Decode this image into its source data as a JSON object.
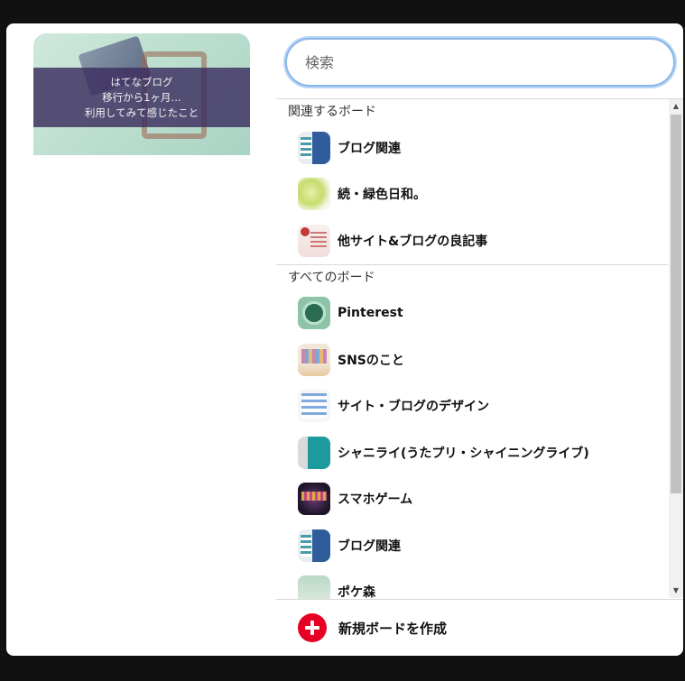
{
  "preview": {
    "lines": [
      "はてなブログ",
      "移行から1ヶ月…",
      "利用してみて感じたこと"
    ]
  },
  "search": {
    "placeholder": "検索",
    "value": ""
  },
  "related_section": {
    "title": "関連するボード",
    "items": [
      {
        "name": "ブログ関連",
        "icon": "blog-thumbnail"
      },
      {
        "name": "続・緑色日和。",
        "icon": "green-thumbnail"
      },
      {
        "name": "他サイト&ブログの良記事",
        "icon": "articles-thumbnail"
      }
    ]
  },
  "all_section": {
    "title": "すべてのボード",
    "items": [
      {
        "name": "Pinterest",
        "icon": "pinterest-thumbnail"
      },
      {
        "name": "SNSのこと",
        "icon": "sns-thumbnail"
      },
      {
        "name": "サイト・ブログのデザイン",
        "icon": "design-thumbnail"
      },
      {
        "name": "シャニライ(うたプリ・シャイニングライブ)",
        "icon": "shiny-thumbnail"
      },
      {
        "name": "スマホゲーム",
        "icon": "game-thumbnail"
      },
      {
        "name": "ブログ関連",
        "icon": "blog-thumbnail"
      },
      {
        "name": "ポケ森",
        "icon": "poke-thumbnail"
      }
    ]
  },
  "footer": {
    "create_label": "新規ボードを作成",
    "icon": "plus-icon"
  },
  "colors": {
    "accent": "#e60023",
    "focus": "#8ab6e8",
    "background": "#111111"
  }
}
